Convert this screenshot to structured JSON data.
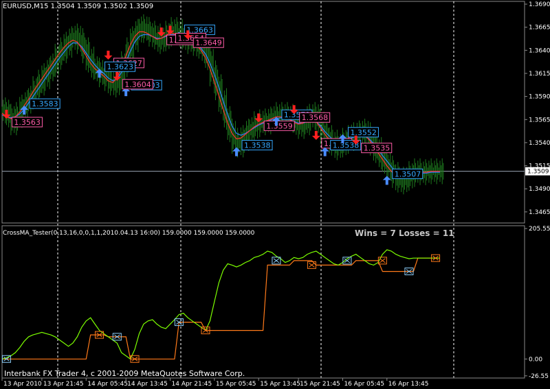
{
  "chart_data": [
    {
      "type": "line",
      "pane": "price",
      "title": "EURUSD,M15  1.3504 1.3509 1.3502 1.3509",
      "ylim": [
        1.3453,
        1.3693
      ],
      "y_ticks": [
        "1.3665",
        "1.3640",
        "1.3615",
        "1.3590",
        "1.3565",
        "1.3540",
        "1.3515",
        "1.3490",
        "1.3465",
        "1.3690"
      ],
      "y_tick_values": [
        1.3665,
        1.364,
        1.3615,
        1.359,
        1.3565,
        1.354,
        1.3515,
        1.349,
        1.3465,
        1.369
      ],
      "current_price": "1.3509",
      "current_price_value": 1.3509,
      "x_count": 100,
      "close": [
        1.3575,
        1.3568,
        1.3562,
        1.357,
        1.3578,
        1.3583,
        1.359,
        1.3598,
        1.3605,
        1.3612,
        1.3618,
        1.3625,
        1.3633,
        1.364,
        1.3646,
        1.3652,
        1.3655,
        1.365,
        1.364,
        1.363,
        1.3622,
        1.3618,
        1.3614,
        1.361,
        1.3605,
        1.3603,
        1.3612,
        1.3625,
        1.364,
        1.3652,
        1.366,
        1.3665,
        1.3662,
        1.3658,
        1.3655,
        1.365,
        1.3653,
        1.3658,
        1.3662,
        1.366,
        1.3655,
        1.3652,
        1.365,
        1.3648,
        1.3645,
        1.364,
        1.363,
        1.3615,
        1.36,
        1.3585,
        1.3568,
        1.3552,
        1.3542,
        1.3538,
        1.3545,
        1.3552,
        1.3556,
        1.356,
        1.3562,
        1.3563,
        1.3565,
        1.3568,
        1.357,
        1.357,
        1.3568,
        1.3565,
        1.356,
        1.3558,
        1.3562,
        1.3568,
        1.357,
        1.3562,
        1.3552,
        1.3545,
        1.354,
        1.3535,
        1.3538,
        1.3542,
        1.3545,
        1.3548,
        1.355,
        1.3552,
        1.3548,
        1.354,
        1.3532,
        1.3525,
        1.3518,
        1.3512,
        1.3505,
        1.35,
        1.3498,
        1.3502,
        1.3506,
        1.3509,
        1.3508,
        1.3508,
        1.3509,
        1.3509,
        1.3509,
        1.3509
      ],
      "ma_fast": [
        1.3572,
        1.3568,
        1.3566,
        1.3568,
        1.3573,
        1.358,
        1.3587,
        1.3595,
        1.3602,
        1.3609,
        1.3616,
        1.3623,
        1.363,
        1.3637,
        1.3643,
        1.3648,
        1.3651,
        1.3649,
        1.3642,
        1.3634,
        1.3626,
        1.362,
        1.3616,
        1.3612,
        1.3607,
        1.3605,
        1.361,
        1.3621,
        1.3634,
        1.3646,
        1.3655,
        1.366,
        1.366,
        1.3658,
        1.3655,
        1.3652,
        1.3653,
        1.3656,
        1.3659,
        1.3658,
        1.3655,
        1.3652,
        1.365,
        1.3648,
        1.3645,
        1.364,
        1.3632,
        1.362,
        1.3606,
        1.3591,
        1.3576,
        1.3561,
        1.355,
        1.3544,
        1.3545,
        1.3549,
        1.3553,
        1.3557,
        1.356,
        1.3562,
        1.3564,
        1.3566,
        1.3568,
        1.3568,
        1.3567,
        1.3565,
        1.3562,
        1.356,
        1.3561,
        1.3565,
        1.3567,
        1.3563,
        1.3556,
        1.3549,
        1.3543,
        1.3539,
        1.3539,
        1.3541,
        1.3544,
        1.3547,
        1.3549,
        1.355,
        1.3548,
        1.3543,
        1.3536,
        1.3529,
        1.3522,
        1.3515,
        1.3509,
        1.3504,
        1.3501,
        1.3502,
        1.3505,
        1.3507,
        1.3508,
        1.3508,
        1.3508,
        1.3509,
        1.3509,
        1.3509
      ],
      "ma_slow": [
        1.357,
        1.3568,
        1.3567,
        1.3568,
        1.3571,
        1.3576,
        1.3583,
        1.359,
        1.3597,
        1.3604,
        1.3611,
        1.3618,
        1.3625,
        1.3632,
        1.3638,
        1.3644,
        1.3648,
        1.3648,
        1.3644,
        1.3637,
        1.363,
        1.3624,
        1.3619,
        1.3615,
        1.361,
        1.3607,
        1.3609,
        1.3616,
        1.3627,
        1.3639,
        1.3649,
        1.3655,
        1.3657,
        1.3657,
        1.3655,
        1.3653,
        1.3653,
        1.3655,
        1.3657,
        1.3657,
        1.3655,
        1.3653,
        1.3651,
        1.3649,
        1.3646,
        1.3642,
        1.3636,
        1.3626,
        1.3614,
        1.36,
        1.3585,
        1.357,
        1.3558,
        1.355,
        1.3548,
        1.355,
        1.3553,
        1.3556,
        1.3559,
        1.3561,
        1.3563,
        1.3565,
        1.3566,
        1.3567,
        1.3567,
        1.3565,
        1.3563,
        1.3561,
        1.3561,
        1.3563,
        1.3565,
        1.3563,
        1.3558,
        1.3552,
        1.3547,
        1.3542,
        1.3541,
        1.3541,
        1.3543,
        1.3545,
        1.3547,
        1.3548,
        1.3547,
        1.3544,
        1.3539,
        1.3533,
        1.3526,
        1.352,
        1.3514,
        1.3508,
        1.3504,
        1.3503,
        1.3504,
        1.3505,
        1.3506,
        1.3507,
        1.3507,
        1.3508,
        1.3508,
        1.3508
      ],
      "signals": [
        {
          "label": "1.3563",
          "type": "sell",
          "x": 1,
          "y": 1.3563,
          "color": "#ff5ca8"
        },
        {
          "label": "1.3583",
          "type": "buy",
          "x": 5,
          "y": 1.3583,
          "color": "#35a8ff"
        },
        {
          "label": "1.3627",
          "type": "sell",
          "x": 24,
          "y": 1.3627,
          "color": "#ff5ca8"
        },
        {
          "label": "1.3623",
          "type": "buy",
          "x": 22,
          "y": 1.3623,
          "color": "#35a8ff"
        },
        {
          "label": "1.3603",
          "type": "buy",
          "x": 28,
          "y": 1.3603,
          "color": "#35a8ff"
        },
        {
          "label": "1.3604",
          "type": "sell",
          "x": 26,
          "y": 1.3604,
          "color": "#ff5ca8"
        },
        {
          "label": "1.3663",
          "type": "buy",
          "x": 40,
          "y": 1.3663,
          "color": "#35a8ff"
        },
        {
          "label": "1.3652",
          "type": "sell",
          "x": 36,
          "y": 1.3652,
          "color": "#ff5ca8"
        },
        {
          "label": "1.3654",
          "type": "sell",
          "x": 38,
          "y": 1.3654,
          "color": "#ff5ca8"
        },
        {
          "label": "1.3649",
          "type": "sell",
          "x": 42,
          "y": 1.3649,
          "color": "#ff5ca8"
        },
        {
          "label": "1.3538",
          "type": "buy",
          "x": 53,
          "y": 1.3538,
          "color": "#35a8ff"
        },
        {
          "label": "1.3559",
          "type": "sell",
          "x": 58,
          "y": 1.3559,
          "color": "#ff5ca8"
        },
        {
          "label": "1.3571",
          "type": "buy",
          "x": 62,
          "y": 1.3571,
          "color": "#35a8ff"
        },
        {
          "label": "1.3568",
          "type": "sell",
          "x": 66,
          "y": 1.3568,
          "color": "#ff5ca8"
        },
        {
          "label": "1.3540",
          "type": "sell",
          "x": 71,
          "y": 1.354,
          "color": "#ff5ca8"
        },
        {
          "label": "1.3538",
          "type": "buy",
          "x": 73,
          "y": 1.3538,
          "color": "#35a8ff"
        },
        {
          "label": "1.3552",
          "type": "buy",
          "x": 77,
          "y": 1.3552,
          "color": "#35a8ff"
        },
        {
          "label": "1.3535",
          "type": "sell",
          "x": 80,
          "y": 1.3535,
          "color": "#ff5ca8"
        },
        {
          "label": "1.3507",
          "type": "buy",
          "x": 87,
          "y": 1.3507,
          "color": "#35a8ff"
        }
      ]
    },
    {
      "type": "line",
      "pane": "indicator",
      "title": "CrossMA_Tester(0,13,16,0,0,1,1,2010.04.13 16:00) 159.0000 159.0000 159.0000",
      "annotation": "Wins = 7 Losses = 11",
      "ylim": [
        -30,
        210
      ],
      "y_ticks": [
        "205.55",
        "0.00",
        "-26.55"
      ],
      "y_tick_values": [
        205.55,
        0.0,
        -26.55
      ],
      "x_labels": [
        "13 Apr 2010",
        "13 Apr 21:45",
        "14 Apr 05:45",
        "14 Apr 13:45",
        "14 Apr 21:45",
        "15 Apr 05:45",
        "15 Apr 13:45",
        "15 Apr 21:45",
        "16 Apr 05:45",
        "16 Apr 13:45"
      ],
      "x_label_positions": [
        0,
        9,
        19,
        28,
        38,
        48,
        58,
        67,
        77,
        87
      ],
      "equity_line": [
        0,
        2,
        5,
        10,
        18,
        28,
        35,
        38,
        40,
        42,
        40,
        38,
        35,
        30,
        25,
        20,
        25,
        35,
        50,
        60,
        65,
        55,
        45,
        40,
        35,
        30,
        25,
        10,
        5,
        0,
        15,
        40,
        55,
        60,
        62,
        55,
        50,
        48,
        55,
        62,
        70,
        72,
        65,
        60,
        55,
        50,
        45,
        60,
        90,
        120,
        140,
        150,
        148,
        145,
        148,
        152,
        155,
        160,
        162,
        165,
        170,
        168,
        162,
        158,
        152,
        155,
        160,
        158,
        160,
        165,
        168,
        170,
        165,
        160,
        155,
        150,
        148,
        152,
        158,
        162,
        165,
        160,
        155,
        150,
        148,
        152,
        165,
        172,
        170,
        165,
        162,
        160,
        158,
        159,
        159,
        159,
        159,
        159,
        159,
        159
      ],
      "balance_line": [
        0,
        0,
        0,
        0,
        0,
        0,
        0,
        0,
        0,
        0,
        0,
        0,
        0,
        0,
        0,
        0,
        0,
        0,
        0,
        0,
        38,
        38,
        38,
        38,
        35,
        35,
        35,
        35,
        35,
        0,
        0,
        0,
        0,
        0,
        0,
        0,
        0,
        0,
        0,
        0,
        58,
        58,
        58,
        58,
        58,
        58,
        45,
        45,
        45,
        45,
        45,
        45,
        45,
        45,
        45,
        45,
        45,
        45,
        45,
        45,
        148,
        148,
        148,
        148,
        148,
        148,
        155,
        155,
        155,
        155,
        155,
        148,
        148,
        148,
        148,
        148,
        148,
        148,
        148,
        148,
        155,
        155,
        155,
        155,
        155,
        155,
        138,
        138,
        138,
        138,
        138,
        138,
        138,
        138,
        159,
        159,
        159,
        159,
        159,
        159
      ],
      "x_count": 100
    }
  ],
  "footer": {
    "copyright": "Interbank FX Trader 4, c 2001-2009 MetaQuotes Software Corp."
  },
  "colors": {
    "bg": "#000000",
    "grid": "#ffffff",
    "candles": "#1e7a1e",
    "ma_fast": "#ff3030",
    "ma_slow": "#3080ff",
    "equity": "#7dff00",
    "balance": "#ff7a1a",
    "buy": "#4a8cff",
    "sell": "#ff2020"
  }
}
